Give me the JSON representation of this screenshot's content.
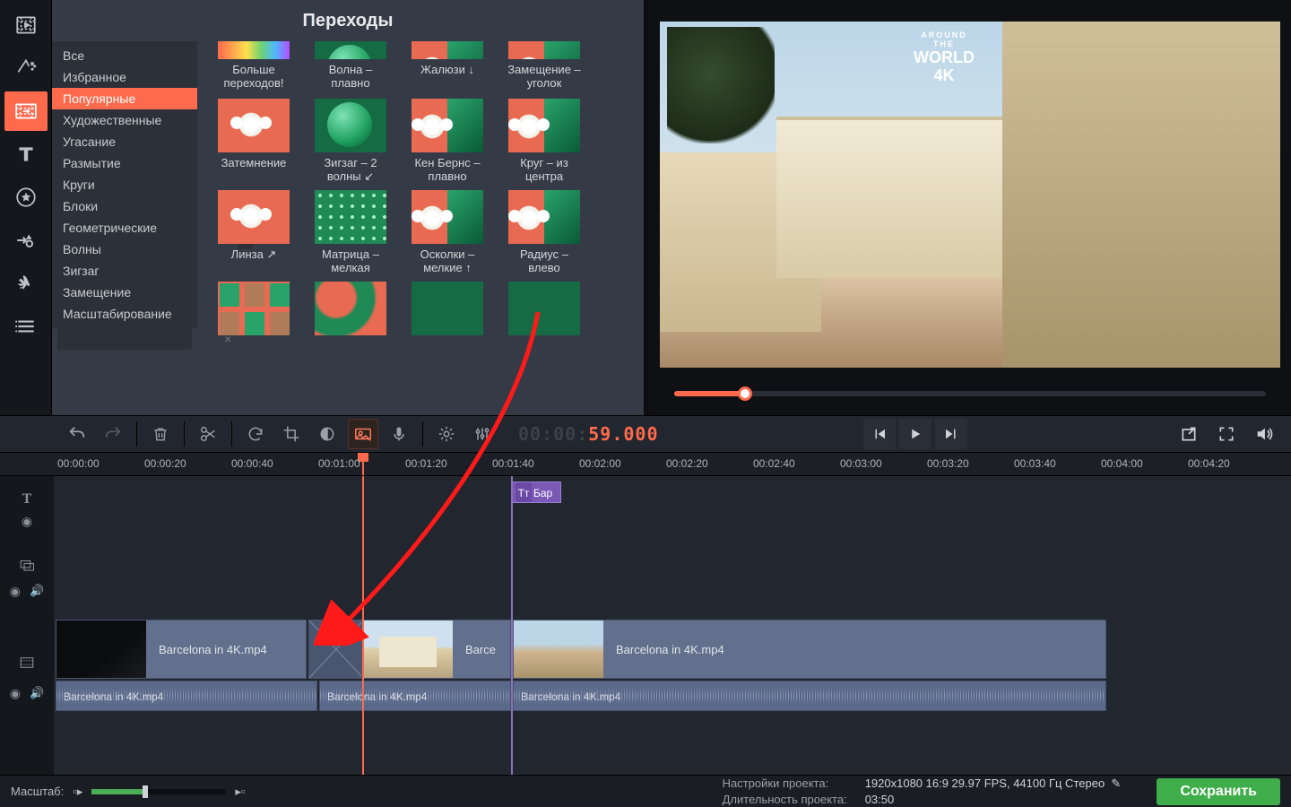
{
  "panel_title": "Переходы",
  "categories": [
    "Все",
    "Избранное",
    "Популярные",
    "Художественные",
    "Угасание",
    "Размытие",
    "Круги",
    "Блоки",
    "Геометрические",
    "Волны",
    "Зигзаг",
    "Замещение",
    "Масштабирование"
  ],
  "selected_category_index": 2,
  "items_row0": [
    "Больше переходов!",
    "Волна – плавно",
    "Жалюзи ↓",
    "Замещение – уголок"
  ],
  "items_row1": [
    "Затемнение",
    "Зигзаг – 2 волны ↙",
    "Кен Бернс – плавно",
    "Круг – из центра"
  ],
  "items_row2": [
    "Линза ↗",
    "Матрица – мелкая",
    "Осколки – мелкие ↑",
    "Радиус – влево"
  ],
  "items_row3": [
    "",
    "",
    "",
    ""
  ],
  "badge4k_small": "AROUND THE",
  "badge4k_big": "WORLD 4K",
  "timecode_prefix": "00:00:",
  "timecode_live": "59.000",
  "ruler_labels": [
    "00:00:00",
    "00:00:20",
    "00:00:40",
    "00:01:00",
    "00:01:20",
    "00:01:40",
    "00:02:00",
    "00:02:20",
    "00:02:40",
    "00:03:00",
    "00:03:20",
    "00:03:40",
    "00:04:00",
    "00:04:20"
  ],
  "title_clip_label": "Бар",
  "clip_name": "Barcelona in 4K.mp4",
  "clip_short": "Barce",
  "zoom_label": "Масштаб:",
  "proj_settings_label": "Настройки проекта:",
  "proj_settings_value": "1920x1080 16:9 29.97 FPS, 44100 Гц Стерео",
  "proj_duration_label": "Длительность проекта:",
  "proj_duration_value": "03:50",
  "save_label": "Сохранить",
  "title_T": "Tᴛ",
  "search_clear": "×",
  "collapse": "‹",
  "pencil": "✎"
}
